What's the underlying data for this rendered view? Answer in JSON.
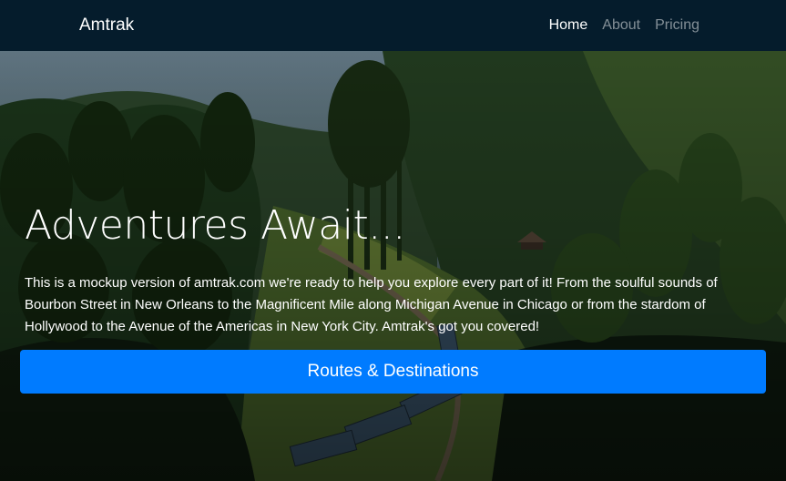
{
  "navbar": {
    "brand": "Amtrak",
    "links": [
      {
        "label": "Home",
        "active": true
      },
      {
        "label": "About",
        "active": false
      },
      {
        "label": "Pricing",
        "active": false
      }
    ]
  },
  "hero": {
    "headline": "Adventures Await...",
    "lead": "This is a mockup version of amtrak.com we're ready to help you explore every part of it! From the soulful sounds of Bourbon Street in New Orleans to the Magnificent Mile along Michigan Avenue in Chicago or from the stardom of Hollywood to the Avenue of the Americas in New York City. Amtrak's got you covered!",
    "cta_label": "Routes & Destinations"
  },
  "colors": {
    "navbar_bg": "#051c2c",
    "primary_button": "#007bff"
  }
}
